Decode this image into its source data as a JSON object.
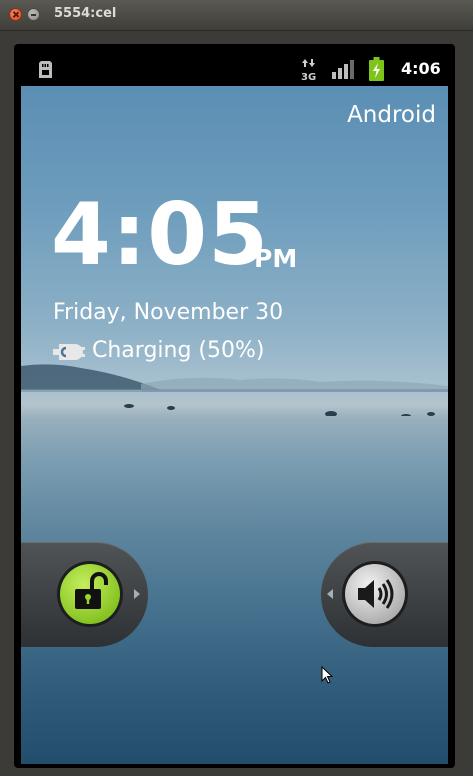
{
  "window": {
    "title": "5554:cel"
  },
  "status_bar": {
    "time": "4:06",
    "network_type": "3G",
    "icons": [
      "sd-card-icon",
      "3g-data-icon",
      "signal-icon",
      "battery-charging-icon"
    ],
    "battery_color": "#7fc41a"
  },
  "lockscreen": {
    "carrier": "Android",
    "time": "4:05",
    "ampm": "PM",
    "date": "Friday, November 30",
    "charging_status": "Charging (50%)",
    "unlock_tab": {
      "icon": "unlock-icon",
      "color": "#9bd42b"
    },
    "sound_tab": {
      "icon": "speaker-icon"
    }
  }
}
